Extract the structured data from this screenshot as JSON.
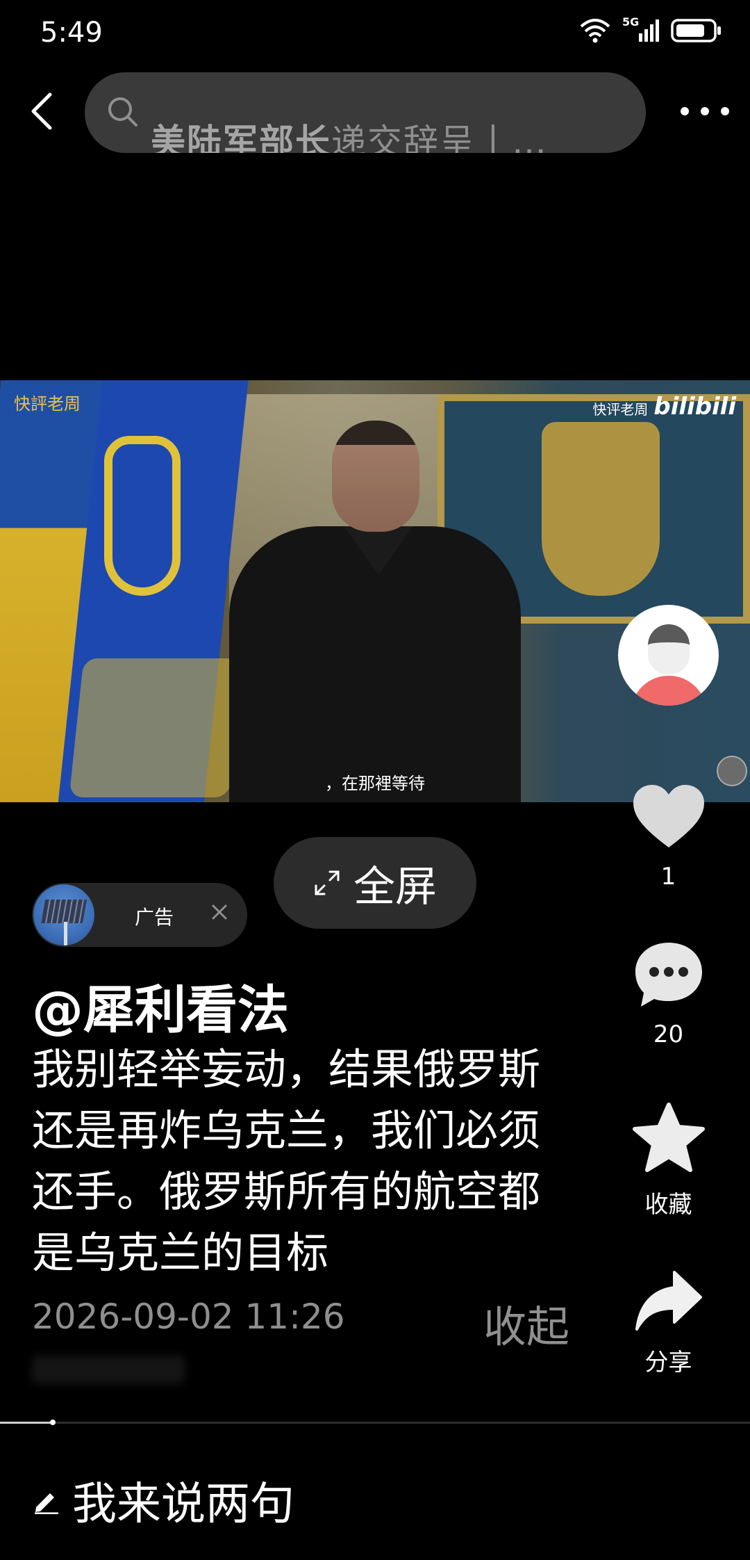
{
  "status_bar": {
    "time": "5:49",
    "network": "5G",
    "icons": [
      "wifi-icon",
      "signal-icon",
      "battery-icon"
    ]
  },
  "top_bar": {
    "search_query_bold": "美陆军部长",
    "search_query_rest": "递交辞呈丨…"
  },
  "video": {
    "watermark_left": "快評老周",
    "watermark_right_text": "快评老周",
    "watermark_right_logo": "bilibili",
    "subtitle": "，在那裡等待"
  },
  "fullscreen": {
    "label": "全屏"
  },
  "ad": {
    "label": "广告"
  },
  "post": {
    "author": "@犀利看法",
    "description": "我别轻举妄动，结果俄罗斯还是再炸乌克兰，我们必须还手。俄罗斯所有的航空都是乌克兰的目标",
    "date": "2026-09-02 11:26",
    "collapse_label": "收起"
  },
  "actions": {
    "like_count": "1",
    "comment_count": "20",
    "favorite_label": "收藏",
    "share_label": "分享"
  },
  "playback": {
    "progress": 0.07
  },
  "comment_bar": {
    "placeholder": "我来说两句"
  },
  "colors": {
    "background": "#000000",
    "pill": "#3a3a3a",
    "secondary_text": "#8f8f8f",
    "avatar_shirt": "#f06a6a"
  }
}
